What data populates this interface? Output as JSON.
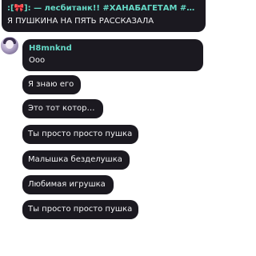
{
  "header_message": {
    "sender": ":[🎀]: — лесбитанк!! #ХАНАБАГЕТАМ #Тю...",
    "text": "Я ПУШКИНА НА ПЯТЬ РАССКАЗАЛА"
  },
  "thread": {
    "author": "H8mnknd",
    "first_message": "Ооо",
    "messages": [
      "Я знаю его",
      "Это тот который",
      "Ты просто просто пушка",
      "Малышка безделушка",
      "Любимая игрушка",
      "Ты просто просто пушка"
    ]
  },
  "colors": {
    "bubble": "#1b1920",
    "name": "#66d9c7",
    "text": "#f2f2f4"
  }
}
